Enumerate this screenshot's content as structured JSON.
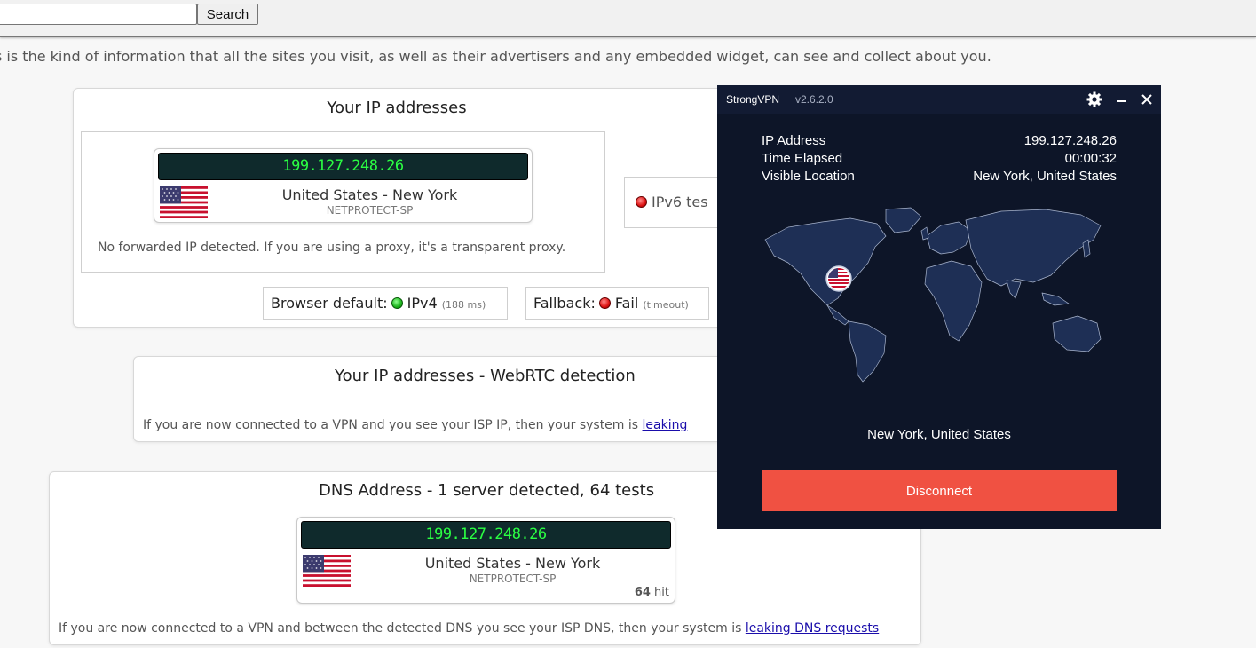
{
  "search": {
    "placeholder": "",
    "button_label": "Search"
  },
  "intro_text": "s is the kind of information that all the sites you visit, as well as their advertisers and any embedded widget, can see and collect about you.",
  "ip_section": {
    "title": "Your IP addresses",
    "ip": "199.127.248.26",
    "location": "United States - New York",
    "isp": "NETPROTECT-SP",
    "forward_note": "No forwarded IP detected. If you are using a proxy, it's a transparent proxy.",
    "ipv6_label": "IPv6 tes",
    "browser_default_label": "Browser default:",
    "browser_default_value": "IPv4",
    "browser_default_time": "(188 ms)",
    "fallback_label": "Fallback:",
    "fallback_value": "Fail",
    "fallback_note": "(timeout)"
  },
  "webrtc_section": {
    "title": "Your IP addresses - WebRTC detection",
    "note": "If you are now connected to a VPN and you see your ISP IP, then your system is ",
    "link": "leaking"
  },
  "dns_section": {
    "title": "DNS Address - 1 server detected, 64 tests",
    "ip": "199.127.248.26",
    "location": "United States - New York",
    "isp": "NETPROTECT-SP",
    "hits": "64",
    "hits_label": "hit",
    "note": "If you are now connected to a VPN and between the detected DNS you see your ISP DNS, then your system is ",
    "link": "leaking DNS requests"
  },
  "vpn": {
    "app_name": "StrongVPN",
    "version": "v2.6.2.0",
    "rows": [
      {
        "key": "IP Address",
        "value": "199.127.248.26"
      },
      {
        "key": "Time Elapsed",
        "value": "00:00:32"
      },
      {
        "key": "Visible Location",
        "value": "New York, United States"
      }
    ],
    "location": "New York, United States",
    "disconnect_label": "Disconnect",
    "icons": [
      "gear-icon",
      "minimize-icon",
      "close-icon"
    ],
    "accent_color": "#f05142"
  }
}
